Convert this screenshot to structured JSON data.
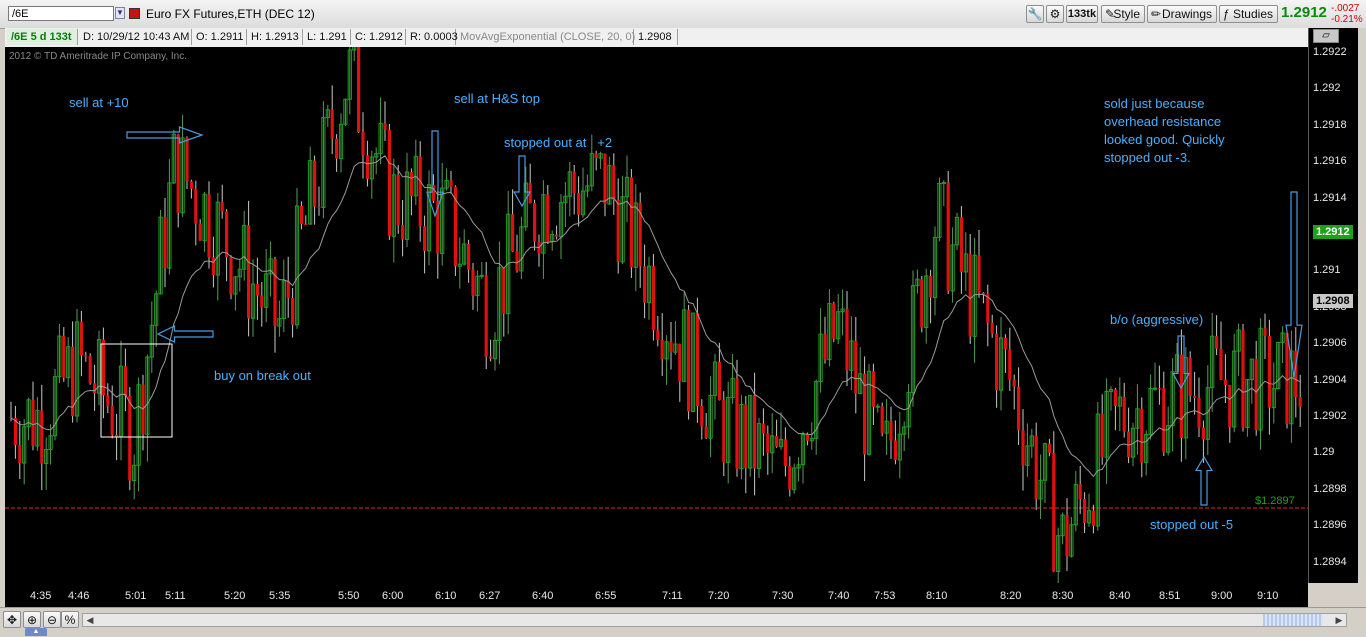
{
  "header": {
    "symbol": "/6E",
    "description": "Euro FX Futures,ETH (DEC 12)",
    "ticks_button": "133tk",
    "style_label": "Style",
    "drawings_label": "Drawings",
    "studies_label": "Studies",
    "last_price": "1.2912",
    "change": "-.0027",
    "change_pct": "-0.21%"
  },
  "info": {
    "chart_id": "/6E 5 d 133t",
    "date": "D: 10/29/12 10:43 AM",
    "open": "O: 1.2911",
    "high": "H: 1.2913",
    "low": "L: 1.291",
    "close": "C: 1.2912",
    "range": "R: 0.0003",
    "study": "MovAvgExponential (CLOSE, 20, 0)",
    "study_value": "1.2908"
  },
  "copyright": "2012 © TD Ameritrade IP Company, Inc.",
  "annotations": {
    "a1": "sell at +10",
    "a2": "sell at H&S top",
    "a3": "stopped out at   +2",
    "a4": "buy on break out",
    "a5": [
      "sold just because",
      "overhead resistance",
      "looked good.  Quickly",
      "stopped out -3."
    ],
    "a6": "b/o (aggressive)",
    "a7": "stopped out -5"
  },
  "price_axis": {
    "ticks": [
      "1.2922",
      "1.292",
      "1.2918",
      "1.2916",
      "1.2914",
      "1.2912",
      "1.291",
      "1.2908",
      "1.2906",
      "1.2904",
      "1.2902",
      "1.29",
      "1.2898",
      "1.2896",
      "1.2894"
    ],
    "last_tag": "1.2912",
    "ma_tag": "1.2908",
    "level_label": "$1.2897"
  },
  "time_axis": [
    "4:35",
    "4:46",
    "5:01",
    "5:11",
    "5:20",
    "5:35",
    "5:50",
    "6:00",
    "6:10",
    "6:27",
    "6:40",
    "6:55",
    "7:11",
    "7:20",
    "7:30",
    "7:40",
    "7:53",
    "8:10",
    "8:20",
    "8:30",
    "8:40",
    "8:51",
    "9:00",
    "9:10"
  ],
  "colors": {
    "up": "#1aa31a",
    "down": "#e01010",
    "ma": "#9a9a9a",
    "annotation": "#4ab0ff",
    "level": "#e03020"
  },
  "chart_data": {
    "type": "candlestick",
    "y_range": [
      1.2893,
      1.2923
    ],
    "level": 1.2897,
    "keypoints": [
      {
        "t": "4:35",
        "p": 1.2902
      },
      {
        "t": "4:46",
        "p": 1.2905
      },
      {
        "t": "5:01",
        "p": 1.2901
      },
      {
        "t": "5:11",
        "p": 1.2916
      },
      {
        "t": "5:20",
        "p": 1.2911
      },
      {
        "t": "5:35",
        "p": 1.2907
      },
      {
        "t": "5:50",
        "p": 1.2921
      },
      {
        "t": "6:00",
        "p": 1.2914
      },
      {
        "t": "6:10",
        "p": 1.2913
      },
      {
        "t": "6:27",
        "p": 1.2908
      },
      {
        "t": "6:40",
        "p": 1.2914
      },
      {
        "t": "6:55",
        "p": 1.2915
      },
      {
        "t": "7:11",
        "p": 1.2907
      },
      {
        "t": "7:20",
        "p": 1.2902
      },
      {
        "t": "7:30",
        "p": 1.2899
      },
      {
        "t": "7:40",
        "p": 1.2907
      },
      {
        "t": "7:53",
        "p": 1.2899
      },
      {
        "t": "8:10",
        "p": 1.2913
      },
      {
        "t": "8:20",
        "p": 1.2904
      },
      {
        "t": "8:30",
        "p": 1.2895
      },
      {
        "t": "8:40",
        "p": 1.2902
      },
      {
        "t": "8:51",
        "p": 1.2903
      },
      {
        "t": "9:00",
        "p": 1.2904
      },
      {
        "t": "9:10",
        "p": 1.2904
      }
    ]
  }
}
